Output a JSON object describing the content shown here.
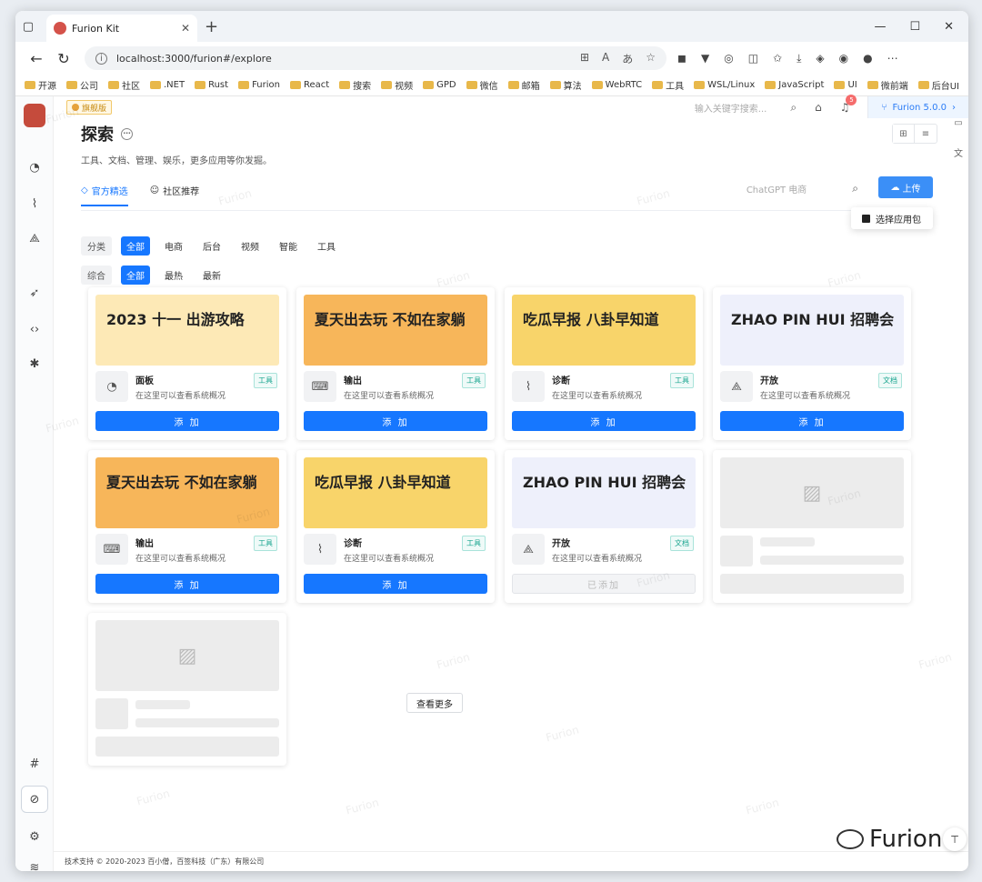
{
  "browser": {
    "tab_title": "Furion Kit",
    "url": "localhost:3000/furion#/explore",
    "bookmarks": [
      "开源",
      "公司",
      "社区",
      ".NET",
      "Rust",
      "Furion",
      "React",
      "搜索",
      "视频",
      "GPD",
      "微信",
      "邮箱",
      "算法",
      "WebRTC",
      "工具",
      "WSL/Linux",
      "JavaScript",
      "UI",
      "微前端",
      "后台UI"
    ]
  },
  "topbar": {
    "flag": "旗舰版",
    "search_placeholder": "输入关键字搜索...",
    "notification_count": "5",
    "version": "Furion 5.0.0"
  },
  "page": {
    "title": "探索",
    "subtitle": "工具、文档、管理、娱乐，更多应用等你发掘。",
    "tabs": [
      "官方精选",
      "社区推荐"
    ],
    "search_placeholder": "ChatGPT 电商",
    "upload_label": "上传",
    "dropdown_item": "选择应用包",
    "filter1": {
      "label": "分类",
      "options": [
        "全部",
        "电商",
        "后台",
        "视频",
        "智能",
        "工具"
      ]
    },
    "filter2": {
      "label": "综合",
      "options": [
        "全部",
        "最热",
        "最新"
      ]
    },
    "more_label": "查看更多",
    "footer": "技术支持 © 2020-2023 百小僧，百签科技（广东）有限公司"
  },
  "cards": [
    {
      "banner": "2023 十一 出游攻略",
      "name": "面板",
      "desc": "在这里可以查看系统概况",
      "tag": "工具",
      "btn": "添 加",
      "bg": "#fde9b6"
    },
    {
      "banner": "夏天出去玩 不如在家躺",
      "name": "输出",
      "desc": "在这里可以查看系统概况",
      "tag": "工具",
      "btn": "添 加",
      "bg": "#f7b65a"
    },
    {
      "banner": "吃瓜早报 八卦早知道",
      "name": "诊断",
      "desc": "在这里可以查看系统概况",
      "tag": "工具",
      "btn": "添 加",
      "bg": "#f8d46a"
    },
    {
      "banner": "ZHAO PIN HUI 招聘会",
      "name": "开放",
      "desc": "在这里可以查看系统概况",
      "tag": "文档",
      "btn": "添 加",
      "bg": "#eef0fb"
    },
    {
      "banner": "夏天出去玩 不如在家躺",
      "name": "输出",
      "desc": "在这里可以查看系统概况",
      "tag": "工具",
      "btn": "添 加",
      "bg": "#f7b65a"
    },
    {
      "banner": "吃瓜早报 八卦早知道",
      "name": "诊断",
      "desc": "在这里可以查看系统概况",
      "tag": "工具",
      "btn": "添 加",
      "bg": "#f8d46a"
    },
    {
      "banner": "ZHAO PIN HUI 招聘会",
      "name": "开放",
      "desc": "在这里可以查看系统概况",
      "tag": "文档",
      "btn": "已添加",
      "bg": "#eef0fb"
    }
  ],
  "brand": "Furion"
}
